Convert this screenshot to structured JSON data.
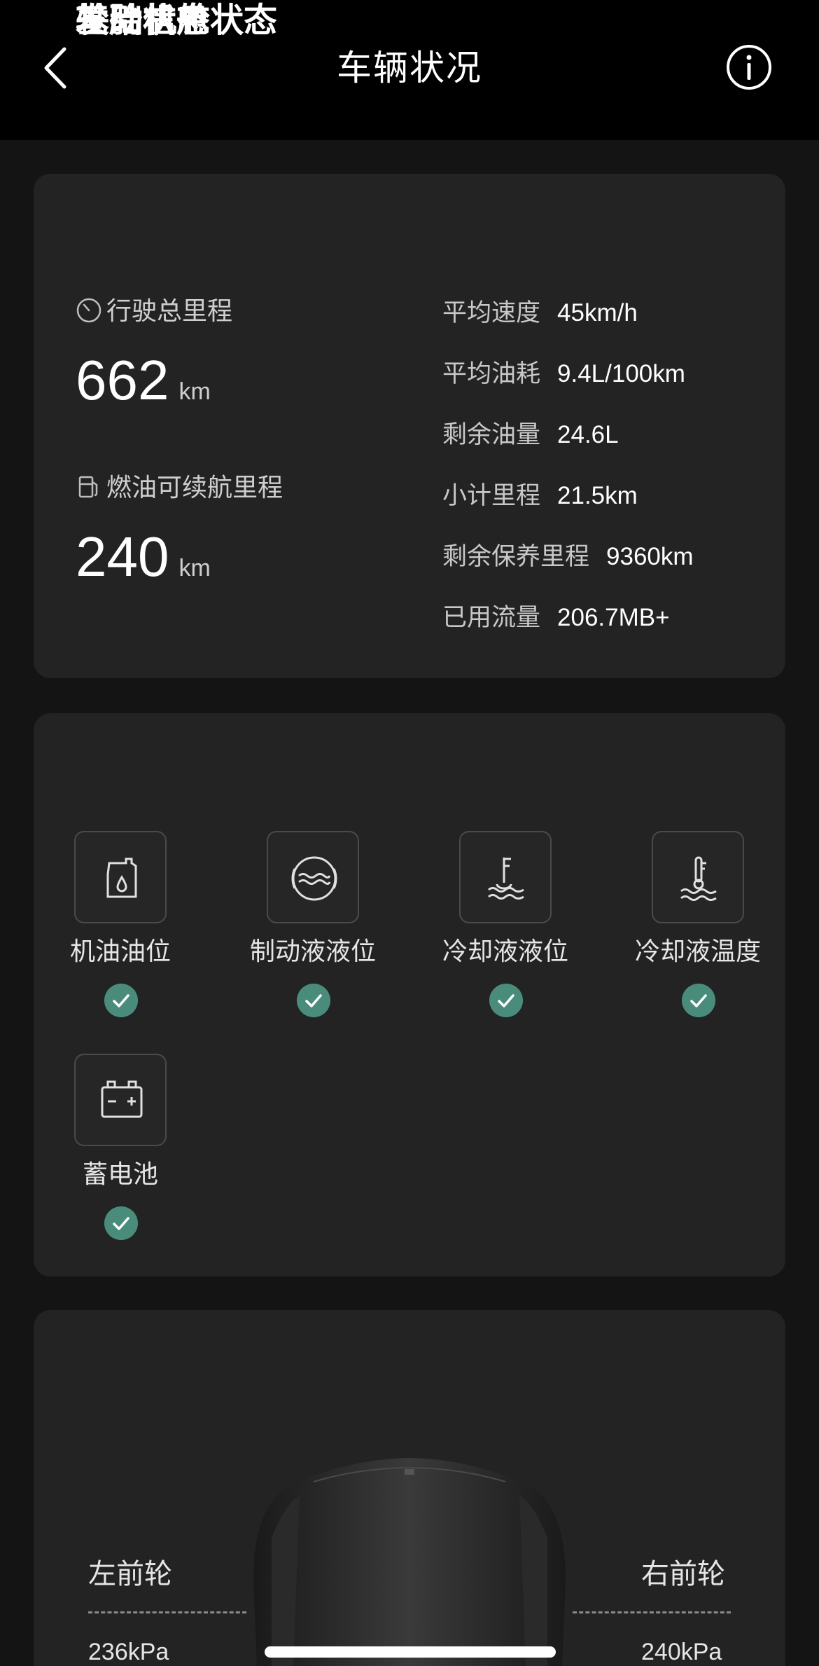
{
  "nav": {
    "title": "车辆状况",
    "back_icon": "chevron-left-icon",
    "info_icon": "info-circle-icon"
  },
  "basic": {
    "title": "基础信息",
    "total_mileage": {
      "label": "行驶总里程",
      "value": "662",
      "unit": "km",
      "icon": "odometer-icon"
    },
    "fuel_range": {
      "label": "燃油可续航里程",
      "value": "240",
      "unit": "km",
      "icon": "fuel-pump-icon"
    },
    "rows": [
      {
        "key": "平均速度",
        "value": "45km/h"
      },
      {
        "key": "平均油耗",
        "value": "9.4L/100km"
      },
      {
        "key": "剩余油量",
        "value": "24.6L"
      },
      {
        "key": "小计里程",
        "value": "21.5km"
      },
      {
        "key": "剩余保养里程",
        "value": "9360km"
      },
      {
        "key": "已用流量",
        "value": "206.7MB+"
      }
    ]
  },
  "engine": {
    "title": "发动机舱状态",
    "items": [
      {
        "label": "机油油位",
        "icon": "oil-level-icon",
        "status": "ok"
      },
      {
        "label": "制动液液位",
        "icon": "brake-fluid-icon",
        "status": "ok"
      },
      {
        "label": "冷却液液位",
        "icon": "coolant-level-icon",
        "status": "ok"
      },
      {
        "label": "冷却液温度",
        "icon": "coolant-temp-icon",
        "status": "ok"
      },
      {
        "label": "蓄电池",
        "icon": "battery-icon",
        "status": "ok"
      }
    ]
  },
  "tires": {
    "title": "轮胎状态",
    "front_left": {
      "label": "左前轮",
      "pressure": "236kPa"
    },
    "front_right": {
      "label": "右前轮",
      "pressure": "240kPa"
    }
  },
  "colors": {
    "background": "#141414",
    "card": "#232323",
    "ok_green": "#4a8c7c"
  }
}
